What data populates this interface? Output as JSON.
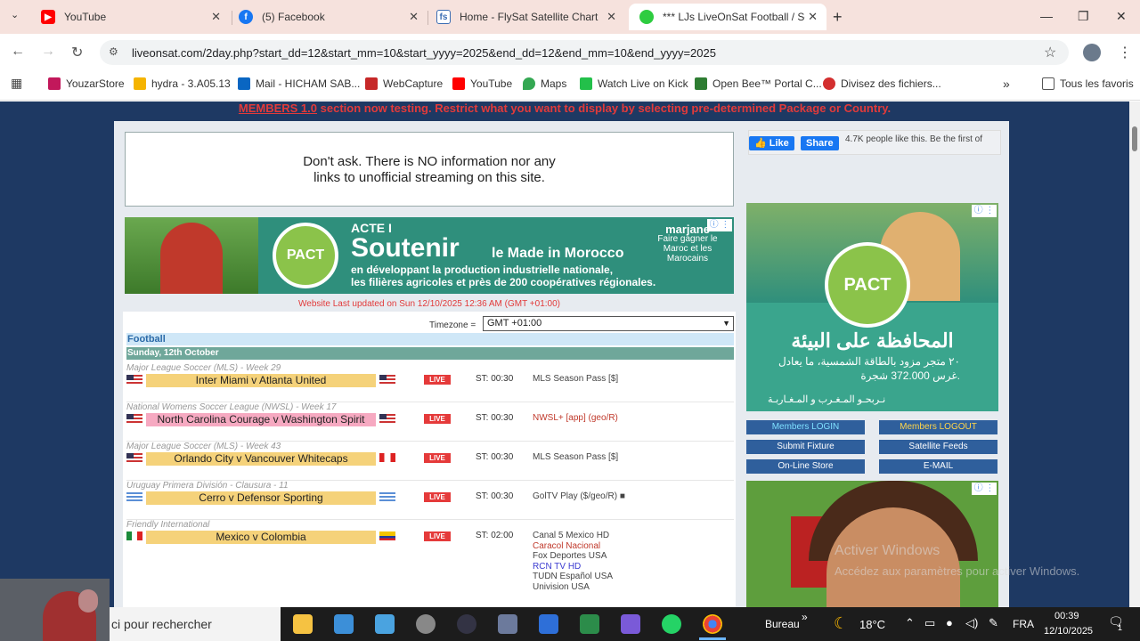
{
  "browser": {
    "tabs": [
      {
        "label": "YouTube",
        "icon": "youtube-icon"
      },
      {
        "label": "(5) Facebook",
        "icon": "facebook-icon"
      },
      {
        "label": "Home - FlySat Satellite Chart",
        "icon": "flysat-icon"
      },
      {
        "label": "*** LJs LiveOnSat Football / Soc",
        "icon": "liveonsat-icon"
      }
    ],
    "url": "liveonsat.com/2day.php?start_dd=12&start_mm=10&start_yyyy=2025&end_dd=12&end_mm=10&end_yyyy=2025",
    "bookmarks": [
      {
        "label": "YouzarStore",
        "color": "#c2185b"
      },
      {
        "label": "hydra - 3.A05.13",
        "color": "#f5b400"
      },
      {
        "label": "Mail - HICHAM SAB...",
        "color": "#0a66c2"
      },
      {
        "label": "WebCapture",
        "color": "#c62828"
      },
      {
        "label": "YouTube",
        "color": "#ff0000"
      },
      {
        "label": "Maps",
        "color": "#34a853"
      },
      {
        "label": "Watch Live on Kick",
        "color": "#23c04a"
      },
      {
        "label": "Open Bee™ Portal C...",
        "color": "#2e7d32"
      },
      {
        "label": "Divisez des fichiers...",
        "color": "#d32f2f"
      }
    ],
    "bookmarks_more": "»",
    "all_bookmarks": "Tous les favoris"
  },
  "site": {
    "members_link": "MEMBERS 1.0",
    "members_text": " section now testing. Restrict what you want to display by selecting pre-determined Package or Country.",
    "notice_line1": "Don't ask. There is NO information nor any",
    "notice_line2": "links to unofficial streaming on this site.",
    "ad_left": {
      "acte": "ACTE I",
      "soutenir": "Soutenir",
      "made": "le Made in Morocco",
      "sub1": "en développant la production industrielle nationale,",
      "sub2": "les filières agricoles et près de 200 coopératives régionales.",
      "logo": "PACT",
      "brand": "marjane",
      "brand_sub": "Faire gagner le Maroc et les Marocains"
    },
    "updated": "Website Last updated on Sun 12/10/2025 12:36 AM (GMT +01:00)",
    "timezone_label": "Timezone =",
    "timezone_value": "GMT +01:00",
    "category": "Football",
    "day": "Sunday, 12th October",
    "matches": [
      {
        "competition": "Major League Soccer (MLS) - Week 29",
        "match": "Inter Miami v Atlanta United",
        "bg": "#f5d27a",
        "live": "LIVE",
        "st": "ST: 00:30",
        "channels": [
          "MLS Season Pass [$]"
        ],
        "chcolor": [
          "#444"
        ]
      },
      {
        "competition": "National Womens Soccer League (NWSL) - Week 17",
        "match": "North Carolina Courage v Washington Spirit",
        "bg": "#f6a9c1",
        "live": "LIVE",
        "st": "ST: 00:30",
        "channels": [
          "NWSL+ [app] (geo/R)"
        ],
        "chcolor": [
          "#c0392b"
        ]
      },
      {
        "competition": "Major League Soccer (MLS) - Week 43",
        "match": "Orlando City v Vancouver Whitecaps",
        "bg": "#f5d27a",
        "live": "LIVE",
        "st": "ST: 00:30",
        "channels": [
          "MLS Season Pass [$]"
        ],
        "chcolor": [
          "#444"
        ]
      },
      {
        "competition": "Uruguay Primera División - Clausura - 11",
        "match": "Cerro v Defensor Sporting",
        "bg": "#f5d27a",
        "live": "LIVE",
        "st": "ST: 00:30",
        "channels": [
          "GolTV Play ($/geo/R) ■"
        ],
        "chcolor": [
          "#444"
        ]
      },
      {
        "competition": "Friendly International",
        "match": "Mexico v Colombia",
        "bg": "#f5d27a",
        "live": "LIVE",
        "st": "ST: 02:00",
        "channels": [
          "Canal 5 Mexico HD",
          "Caracol Nacional",
          "Fox Deportes USA",
          "RCN TV HD",
          "TUDN Español USA",
          "Univision USA"
        ],
        "chcolor": [
          "#444",
          "#c0392b",
          "#444",
          "#3b3bd0",
          "#444",
          "#444"
        ]
      }
    ],
    "fb": {
      "like": "Like",
      "share": "Share",
      "text": "4.7K people like this. Be the first of"
    },
    "ad_right": {
      "logo": "PACT",
      "arabic1": "المحافظة على البيئة",
      "arabic2": "٢٠ متجر مزود بالطاقة الشمسية، ما يعادل",
      "arabic3": "غرس 372.000 شجرة.",
      "arabic4": "نـربحـو المـغـرب و المـغـاربـة"
    },
    "member_buttons": [
      "Members LOGIN",
      "Members LOGOUT",
      "Submit Fixture",
      "Satellite Feeds",
      "On-Line Store",
      "E-MAIL"
    ],
    "activate1": "Activer Windows",
    "activate2": "Accédez aux paramètres pour activer Windows."
  },
  "taskbar": {
    "search": "ci pour rechercher",
    "bureau": "Bureau",
    "weather": "18°C",
    "lang": "FRA",
    "time": "00:39",
    "date": "12/10/2025",
    "notif": "1"
  }
}
